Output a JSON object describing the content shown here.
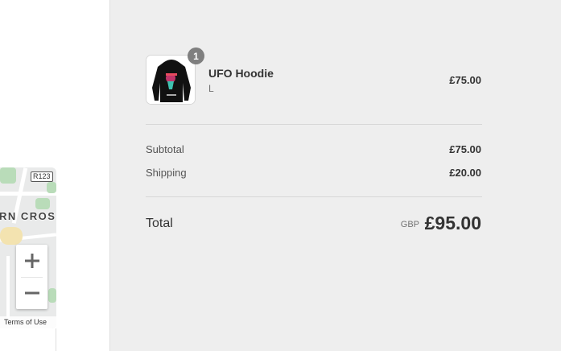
{
  "map": {
    "road_shield": "R123",
    "area_label": "RN CROS",
    "zoom_in_label": "+",
    "zoom_out_label": "−",
    "terms": "Terms of Use"
  },
  "order": {
    "item": {
      "quantity": "1",
      "name": "UFO Hoodie",
      "variant": "L",
      "price": "£75.00",
      "thumbnail_icon": "hoodie-image"
    },
    "subtotal_label": "Subtotal",
    "subtotal_value": "£75.00",
    "shipping_label": "Shipping",
    "shipping_value": "£20.00",
    "total_label": "Total",
    "total_currency": "GBP",
    "total_value": "£95.00"
  },
  "colors": {
    "summary_bg": "#eeeeee",
    "badge": "#7f7f7f",
    "text": "#333333"
  }
}
